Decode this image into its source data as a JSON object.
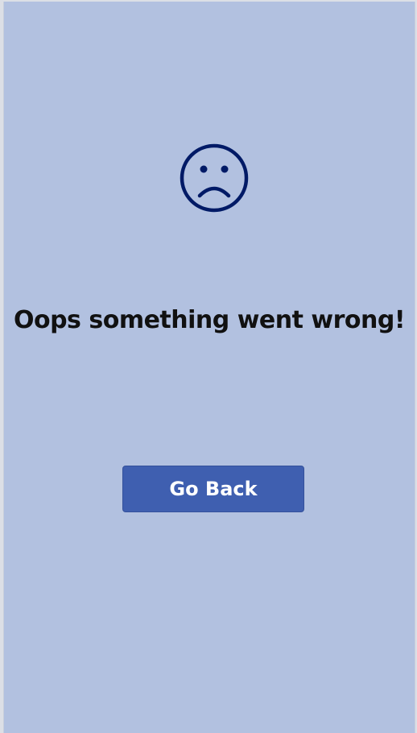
{
  "error_screen": {
    "icon": "sad-face-icon",
    "message": "Oops something went wrong!",
    "button_label": "Go Back"
  },
  "colors": {
    "background": "#b2c1e0",
    "icon": "#001a66",
    "button": "#3f5fb0",
    "button_text": "#ffffff",
    "message_text": "#111111"
  }
}
